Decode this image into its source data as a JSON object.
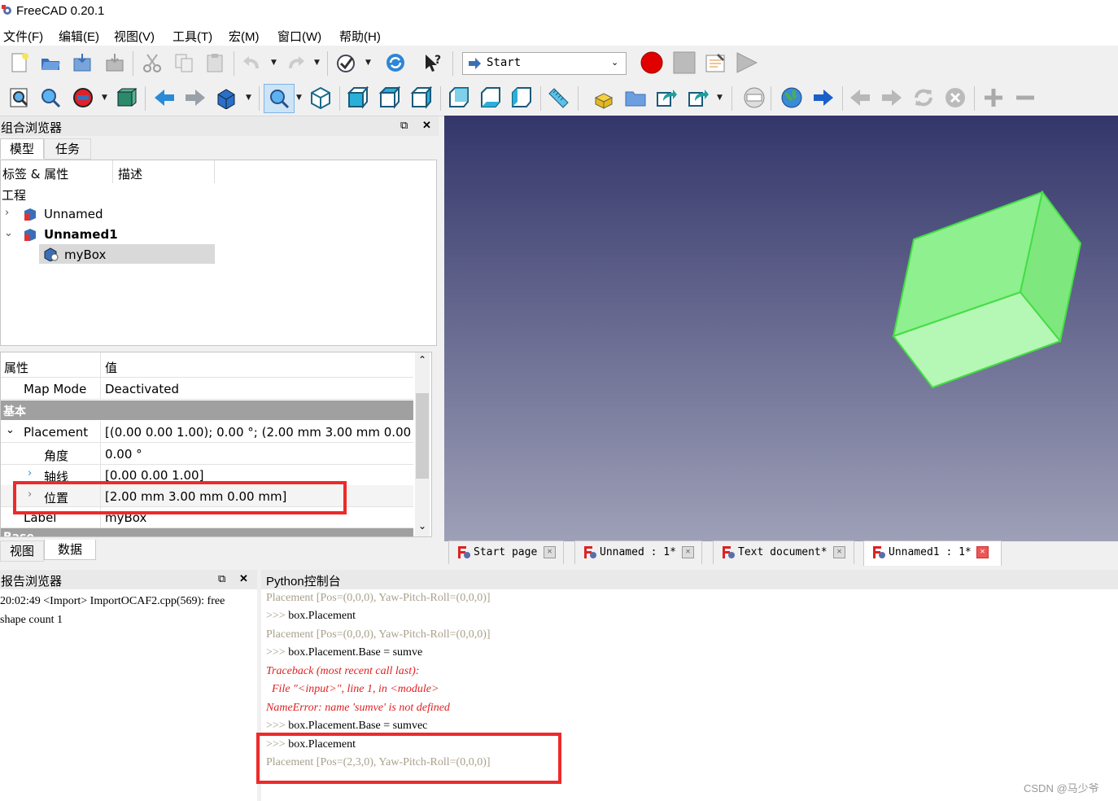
{
  "window": {
    "title": "FreeCAD 0.20.1"
  },
  "menu": [
    "文件(F)",
    "编辑(E)",
    "视图(V)",
    "工具(T)",
    "宏(M)",
    "窗口(W)",
    "帮助(H)"
  ],
  "toolbar": {
    "workbench": "Start"
  },
  "combo": {
    "title": "组合浏览器",
    "tabs": [
      "模型",
      "任务"
    ],
    "tree_headers": [
      "标签 & 属性",
      "描述"
    ],
    "tree_root": "工程",
    "tree_items": [
      "Unnamed",
      "Unnamed1",
      "myBox"
    ],
    "prop_headers": [
      "属性",
      "值"
    ],
    "props": [
      {
        "name": "Map Mode",
        "value": "Deactivated"
      },
      {
        "name": "Placement",
        "value": "[(0.00 0.00 1.00); 0.00 °; (2.00 mm  3.00 mm  0.00 ..."
      },
      {
        "name": "角度",
        "value": "0.00 °"
      },
      {
        "name": "轴线",
        "value": "[0.00 0.00 1.00]"
      },
      {
        "name": "位置",
        "value": "[2.00 mm  3.00 mm  0.00 mm]"
      },
      {
        "name": "Label",
        "value": "myBox"
      }
    ],
    "group_basic": "基本",
    "group_next": "Base",
    "bottom_tabs": [
      "视图",
      "数据"
    ]
  },
  "doc_tabs": [
    "Start  page",
    "Unnamed  :  1*",
    "Text  document*",
    "Unnamed1  :  1*"
  ],
  "report": {
    "title": "报告浏览器",
    "lines": [
      "20:02:49  <Import> ImportOCAF2.cpp(569): free",
      "shape count 1"
    ]
  },
  "python": {
    "title": "Python控制台",
    "lines": [
      {
        "prompt": "",
        "text": "Placement [Pos=(0,0,0), Yaw-Pitch-Roll=(0,0,0)]",
        "kind": "gray"
      },
      {
        "prompt": ">>> ",
        "text": "box.Placement",
        "kind": "cmd"
      },
      {
        "prompt": "",
        "text": "Placement [Pos=(0,0,0), Yaw-Pitch-Roll=(0,0,0)]",
        "kind": "gray"
      },
      {
        "prompt": ">>> ",
        "text": "box.Placement.Base = sumve",
        "kind": "cmd"
      },
      {
        "prompt": "",
        "text": "Traceback (most recent call last):",
        "kind": "err"
      },
      {
        "prompt": "",
        "text": "  File \"<input>\", line 1, in <module>",
        "kind": "err"
      },
      {
        "prompt": "",
        "text": "NameError: name 'sumve' is not defined",
        "kind": "err"
      },
      {
        "prompt": ">>> ",
        "text": "box.Placement.Base = sumvec",
        "kind": "cmd"
      },
      {
        "prompt": ">>> ",
        "text": "box.Placement",
        "kind": "cmd"
      },
      {
        "prompt": "",
        "text": "Placement [Pos=(2,3,0), Yaw-Pitch-Roll=(0,0,0)]",
        "kind": "gray"
      }
    ]
  },
  "watermark": "CSDN @马少爷",
  "colors": {
    "highlight": "#ee2a2a",
    "box_fill": "#9af59a",
    "box_edge": "#4ee04e"
  }
}
